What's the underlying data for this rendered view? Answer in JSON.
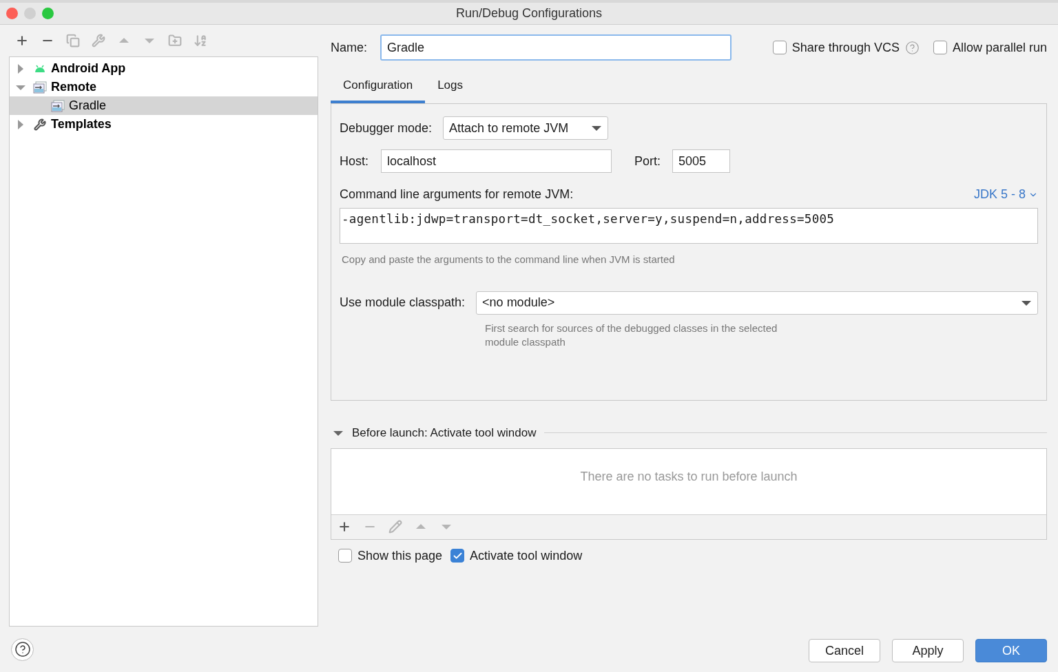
{
  "window": {
    "title": "Run/Debug Configurations"
  },
  "toolbar": [
    {
      "kind": "add",
      "disabled": false
    },
    {
      "kind": "remove",
      "disabled": false
    },
    {
      "kind": "copy",
      "disabled": true
    },
    {
      "kind": "edit",
      "disabled": true
    },
    {
      "kind": "up",
      "disabled": true
    },
    {
      "kind": "down",
      "disabled": true
    },
    {
      "kind": "folder",
      "disabled": true
    },
    {
      "kind": "sort",
      "disabled": true
    }
  ],
  "tree": [
    {
      "label": "Android App",
      "kind": "android",
      "expanded": false,
      "selected": false
    },
    {
      "label": "Remote",
      "kind": "remote",
      "expanded": true,
      "selected": false,
      "children": [
        {
          "label": "Gradle",
          "kind": "remote",
          "selected": true
        }
      ]
    },
    {
      "label": "Templates",
      "kind": "templates",
      "expanded": false,
      "selected": false
    }
  ],
  "name_field": {
    "label": "Name:",
    "value": "Gradle"
  },
  "options": [
    {
      "label": "Share through VCS",
      "checked": false,
      "help": true
    },
    {
      "label": "Allow parallel run",
      "checked": false,
      "help": false
    }
  ],
  "tabs": [
    {
      "label": "Configuration",
      "selected": true
    },
    {
      "label": "Logs",
      "selected": false
    }
  ],
  "debugger_mode": {
    "label": "Debugger mode:",
    "value": "Attach to remote JVM"
  },
  "host": {
    "label": "Host:",
    "value": "localhost"
  },
  "port": {
    "label": "Port:",
    "value": "5005"
  },
  "command_line": {
    "label": "Command line arguments for remote JVM:",
    "jdk_link": "JDK 5 - 8",
    "value": "-agentlib:jdwp=transport=dt_socket,server=y,suspend=n,address=5005",
    "hint": "Copy and paste the arguments to the command line when JVM is started"
  },
  "module_classpath": {
    "label": "Use module classpath:",
    "value": "<no module>",
    "hint": "First search for sources of the debugged classes in the selected module classpath"
  },
  "before_launch": {
    "title": "Before launch: Activate tool window",
    "expanded": true,
    "empty_text": "There are no tasks to run before launch",
    "toolbar": [
      {
        "kind": "add",
        "disabled": false
      },
      {
        "kind": "remove",
        "disabled": true
      },
      {
        "kind": "edit",
        "disabled": true
      },
      {
        "kind": "up",
        "disabled": true
      },
      {
        "kind": "down",
        "disabled": true
      }
    ]
  },
  "launch_options": [
    {
      "label": "Show this page",
      "checked": false
    },
    {
      "label": "Activate tool window",
      "checked": true
    }
  ],
  "buttons": [
    {
      "label": "Cancel",
      "kind": "default"
    },
    {
      "label": "Apply",
      "kind": "default"
    },
    {
      "label": "OK",
      "kind": "primary"
    }
  ]
}
